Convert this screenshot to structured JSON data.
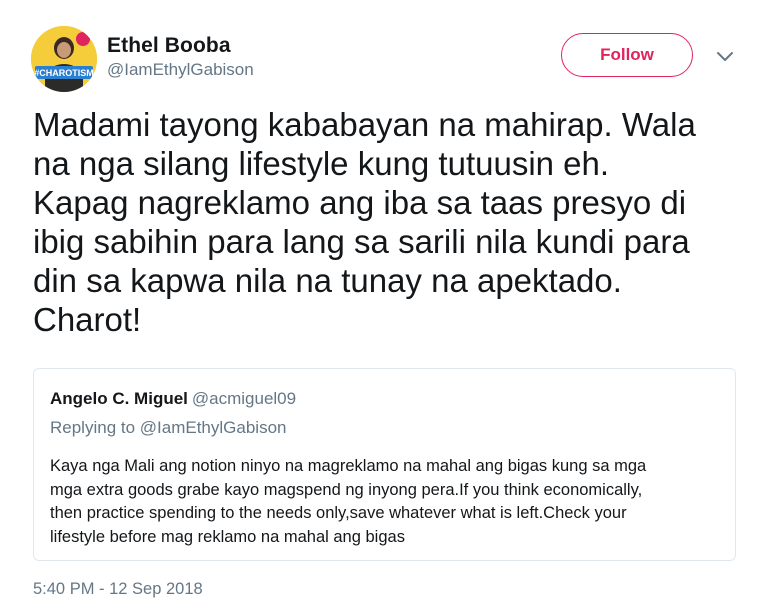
{
  "author": {
    "name": "Ethel Booba",
    "handle": "@IamEthylGabison",
    "avatar_text": "#CHAROTISM"
  },
  "follow_button": {
    "label": "Follow"
  },
  "menu": {
    "icon": "chevron-down-icon"
  },
  "tweet": {
    "text": "Madami tayong kababayan na mahirap. Wala\nna nga silang lifestyle kung tutuusin eh.\nKapag nagreklamo ang iba sa taas presyo di\nibig sabihin para lang sa sarili nila kundi para\ndin sa kapwa nila na tunay na apektado.\nCharot!",
    "timestamp": "5:40 PM - 12 Sep 2018"
  },
  "quoted": {
    "name": "Angelo C. Miguel",
    "handle": "@acmiguel09",
    "replying_to": "Replying to @IamEthylGabison",
    "text": "Kaya nga Mali ang notion ninyo na magreklamo na mahal ang bigas kung sa mga\nmga extra goods grabe kayo magspend ng inyong pera.If you think economically,\nthen practice spending to the needs only,save whatever what is left.Check your\nlifestyle before mag reklamo na mahal ang bigas"
  },
  "colors": {
    "accent": "#e0245e",
    "secondary_text": "#657786",
    "border": "#e1e8ed"
  }
}
